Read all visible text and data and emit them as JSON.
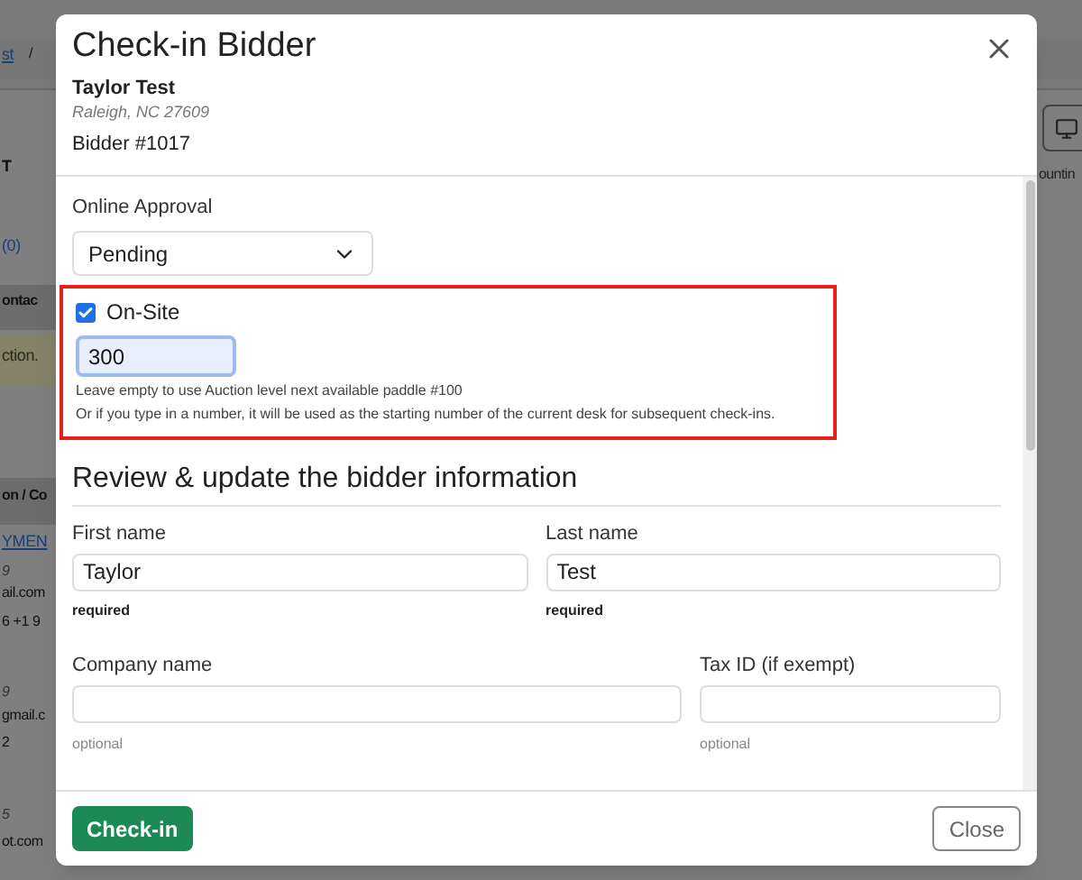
{
  "background": {
    "left_fragments": [
      {
        "text": "st",
        "kind": "link"
      },
      {
        "text": "/",
        "kind": "text"
      },
      {
        "text": "T",
        "kind": "bold"
      },
      {
        "text": "(0)",
        "kind": "link_plain"
      },
      {
        "text": "ontac",
        "kind": "header"
      },
      {
        "text": "ction.",
        "kind": "banner"
      },
      {
        "text": "on / Co",
        "kind": "header"
      },
      {
        "text": "YMEN",
        "kind": "link"
      },
      {
        "text": "9",
        "kind": "italic"
      },
      {
        "text": "ail.com",
        "kind": "text"
      },
      {
        "text": "6  +1 9",
        "kind": "text"
      },
      {
        "text": "9",
        "kind": "italic"
      },
      {
        "text": "gmail.c",
        "kind": "text"
      },
      {
        "text": "2",
        "kind": "text"
      },
      {
        "text": "5",
        "kind": "italic"
      },
      {
        "text": "ot.com",
        "kind": "text"
      }
    ],
    "right_fragments": [
      {
        "text": "ountin"
      }
    ]
  },
  "dialog": {
    "title": "Check-in Bidder",
    "bidder_name": "Taylor Test",
    "bidder_location": "Raleigh, NC 27609",
    "bidder_number": "Bidder #1017",
    "approval": {
      "label": "Online Approval",
      "value": "Pending"
    },
    "onsite": {
      "label": "On-Site",
      "checked": true,
      "highlighted": true,
      "paddle": "300",
      "help": [
        "Leave empty to use Auction level next available paddle #100",
        "Or if you type in a number, it will be used as the starting number of the current desk for subsequent check-ins."
      ]
    },
    "section_title": "Review & update the bidder information",
    "rows": [
      [
        {
          "label": "First name",
          "value": "Taylor",
          "hint": "required",
          "required": true
        },
        {
          "label": "Last name",
          "value": "Test",
          "hint": "required",
          "required": true
        }
      ],
      [
        {
          "label": "Company name",
          "hint": "optional",
          "required": false
        },
        {
          "label": "Tax ID (if exempt)",
          "hint": "optional",
          "required": false
        }
      ]
    ],
    "primary_button": "Check-in",
    "close_button": "Close"
  }
}
